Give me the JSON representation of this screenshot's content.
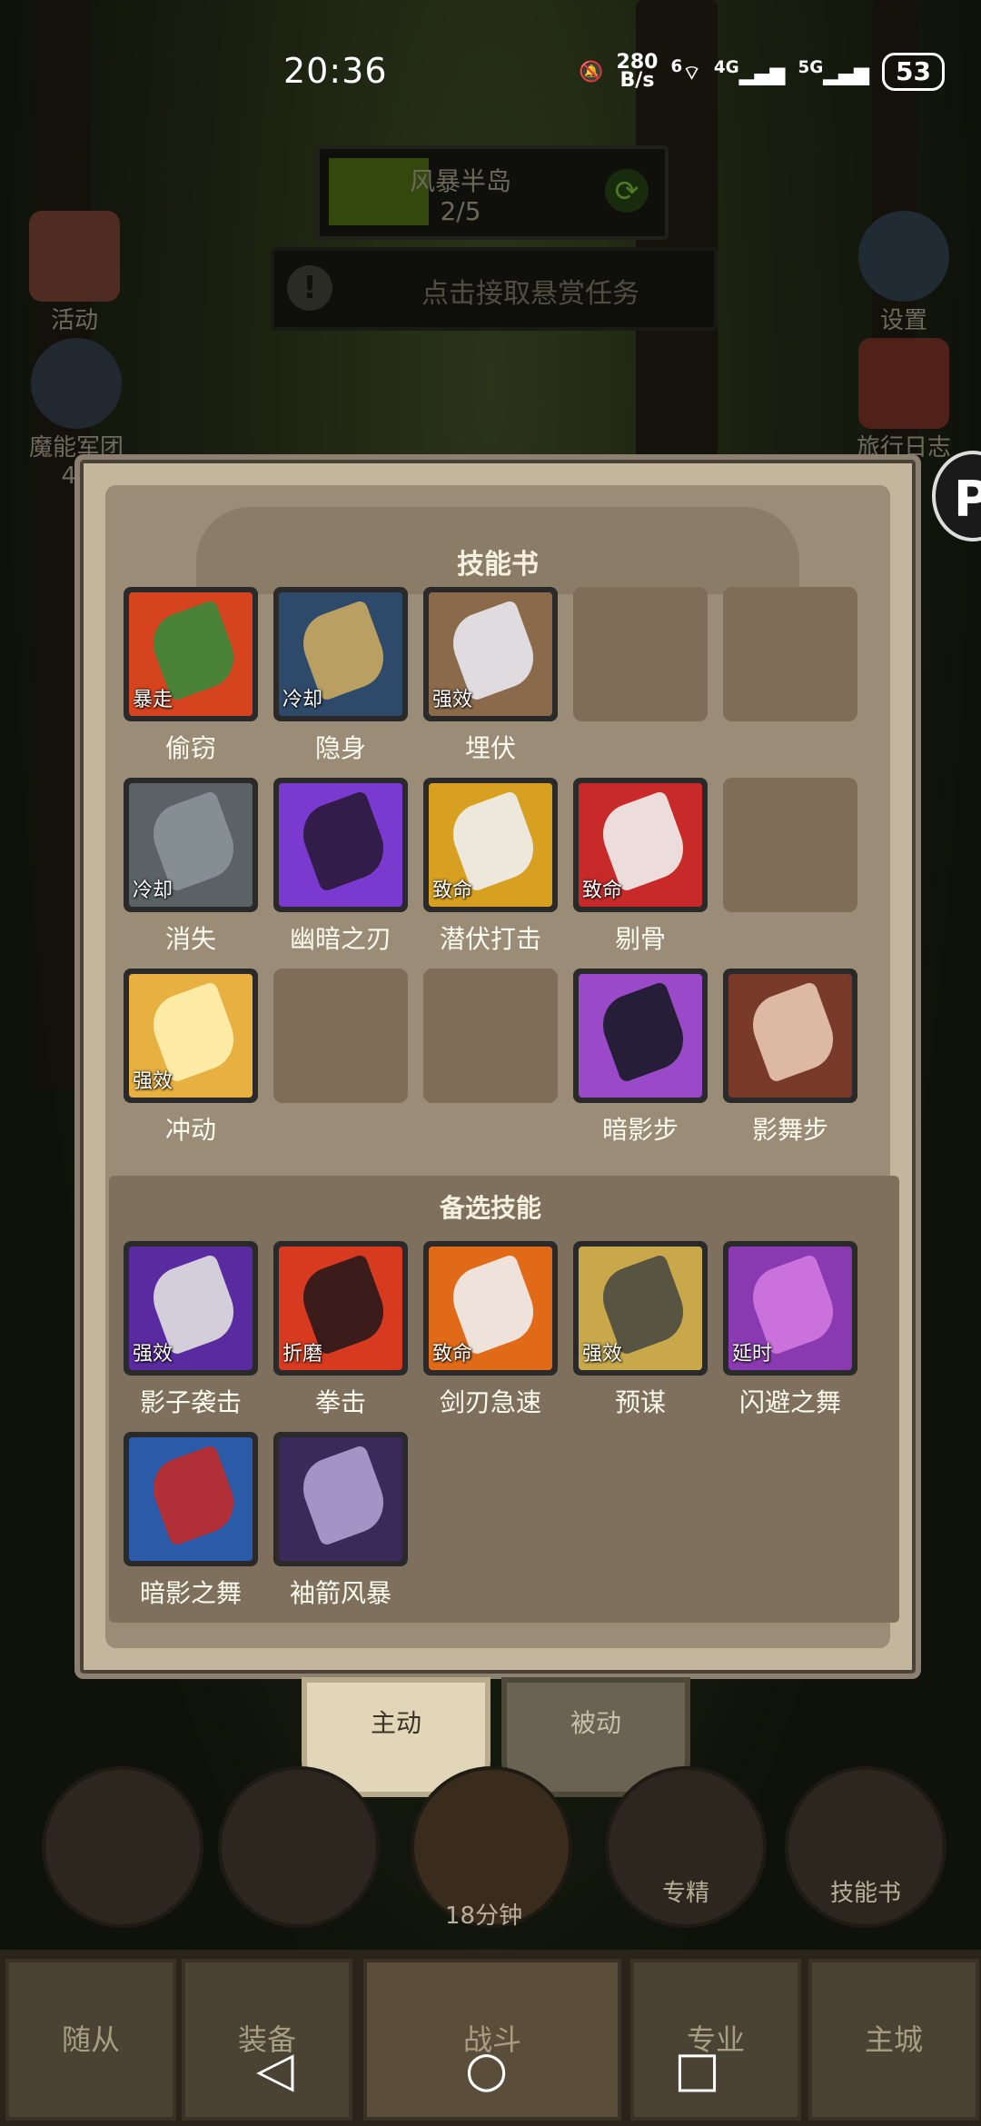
{
  "status": {
    "time": "20:36",
    "net_speed_value": "280",
    "net_speed_unit": "B/s",
    "wifi": "6",
    "sig1": "4G",
    "sig2": "5G",
    "battery": "53"
  },
  "hud": {
    "region_name": "风暴半岛",
    "region_progress": "2/5",
    "bounty_text": "点击接取悬赏任务",
    "left_activity": "活动",
    "left_guild": "魔能军团",
    "left_guild_num": "44",
    "right_settings": "设置",
    "right_journal": "旅行日志"
  },
  "panel": {
    "title": "技能书",
    "alt_title": "备选技能",
    "rows": [
      [
        {
          "name": "偷窃",
          "tag": "暴走",
          "icon": "flower-steal-icon",
          "bg": "#d5441f",
          "fg": "#3a8a3a"
        },
        {
          "name": "隐身",
          "tag": "冷却",
          "icon": "hooded-figure-icon",
          "bg": "#2e4a6a",
          "fg": "#c9a860"
        },
        {
          "name": "埋伏",
          "tag": "强效",
          "icon": "ambush-dagger-icon",
          "bg": "#8a6a4a",
          "fg": "#e8e8f0"
        },
        {
          "empty": true
        },
        {
          "empty": true
        }
      ],
      [
        {
          "name": "消失",
          "tag": "冷却",
          "icon": "vanish-smoke-icon",
          "bg": "#5a6266",
          "fg": "#8a9498"
        },
        {
          "name": "幽暗之刃",
          "tag": "",
          "icon": "shadow-blade-icon",
          "bg": "#7a3ad0",
          "fg": "#2a1a3a"
        },
        {
          "name": "潜伏打击",
          "tag": "致命",
          "icon": "lurk-strike-icon",
          "bg": "#d8a020",
          "fg": "#f0f0f0"
        },
        {
          "name": "剔骨",
          "tag": "致命",
          "icon": "bone-blade-icon",
          "bg": "#c82a2a",
          "fg": "#f0f0f0"
        },
        {
          "empty": true
        }
      ],
      [
        {
          "name": "冲动",
          "tag": "强效",
          "icon": "impulse-swirl-icon",
          "bg": "#e8b040",
          "fg": "#fff2b0"
        },
        {
          "empty": true
        },
        {
          "empty": true
        },
        {
          "name": "暗影步",
          "tag": "",
          "icon": "shadow-step-icon",
          "bg": "#9a4ac8",
          "fg": "#1a1a28"
        },
        {
          "name": "影舞步",
          "tag": "",
          "icon": "shadow-dance-step-icon",
          "bg": "#7a3a2a",
          "fg": "#e8c8b0"
        }
      ]
    ],
    "alternates": [
      {
        "name": "影子袭击",
        "tag": "强效",
        "icon": "shadow-strike-icon",
        "bg": "#5a2aa0",
        "fg": "#e0e0e0"
      },
      {
        "name": "拳击",
        "tag": "折磨",
        "icon": "punch-icon",
        "bg": "#d83a20",
        "fg": "#2a1a1a"
      },
      {
        "name": "剑刃急速",
        "tag": "致命",
        "icon": "blade-rush-icon",
        "bg": "#e06a18",
        "fg": "#f0f0f0"
      },
      {
        "name": "预谋",
        "tag": "强效",
        "icon": "premeditation-face-icon",
        "bg": "#c8a84a",
        "fg": "#4a4a40"
      },
      {
        "name": "闪避之舞",
        "tag": "延时",
        "icon": "evasion-dance-icon",
        "bg": "#8a3ab0",
        "fg": "#d078e0"
      },
      {
        "name": "暗影之舞",
        "tag": "",
        "icon": "shadow-dance-icon",
        "bg": "#2a5aa8",
        "fg": "#c02a2a"
      },
      {
        "name": "袖箭风暴",
        "tag": "",
        "icon": "sleeve-arrow-storm-icon",
        "bg": "#3a2a5a",
        "fg": "#b0a0d0"
      }
    ]
  },
  "tabs": {
    "active": "主动",
    "passive": "被动"
  },
  "bottom": {
    "timer": "18分钟",
    "spec": "专精",
    "skillbook": "技能书",
    "nav": [
      "随从",
      "装备",
      "战斗",
      "专业",
      "主城"
    ]
  }
}
